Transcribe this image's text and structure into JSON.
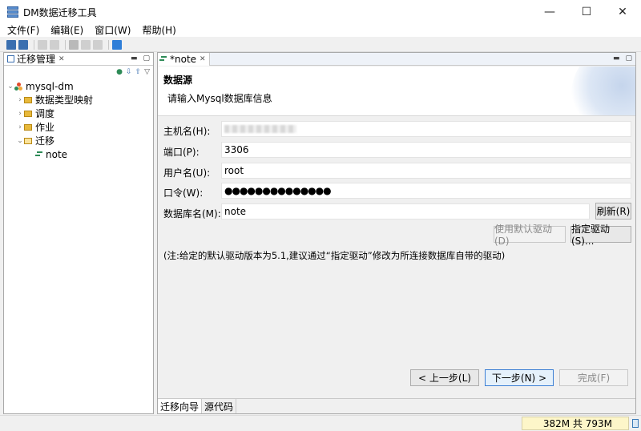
{
  "window": {
    "title": "DM数据迁移工具",
    "minimize": "—",
    "maximize": "☐",
    "close": "✕"
  },
  "menu": [
    "文件(F)",
    "编辑(E)",
    "窗口(W)",
    "帮助(H)"
  ],
  "left_panel": {
    "tab_label": "迁移管理",
    "tree": {
      "root": "mysql-dm",
      "children": [
        "数据类型映射",
        "调度",
        "作业",
        "迁移"
      ],
      "grandchild": "note"
    }
  },
  "editor": {
    "tab_label": "*note",
    "header": {
      "title": "数据源",
      "description": "请输入Mysql数据库信息"
    },
    "fields": {
      "host_label": "主机名(H):",
      "host_value": "",
      "port_label": "端口(P):",
      "port_value": "3306",
      "user_label": "用户名(U):",
      "user_value": "root",
      "password_label": "口令(W):",
      "password_value": "●●●●●●●●●●●●●●",
      "db_label": "数据库名(M):",
      "db_value": "note"
    },
    "buttons": {
      "refresh": "刷新(R)",
      "default_driver": "使用默认驱动(D)",
      "specify_driver": "指定驱动(S)..."
    },
    "note": "(注:给定的默认驱动版本为5.1,建议通过“指定驱动”修改为所连接数据库自带的驱动)",
    "nav": {
      "back": "< 上一步(L)",
      "next": "下一步(N) >",
      "finish": "完成(F)"
    },
    "bottom_tabs": [
      "迁移向导",
      "源代码"
    ]
  },
  "status": {
    "memory": "382M 共 793M"
  }
}
